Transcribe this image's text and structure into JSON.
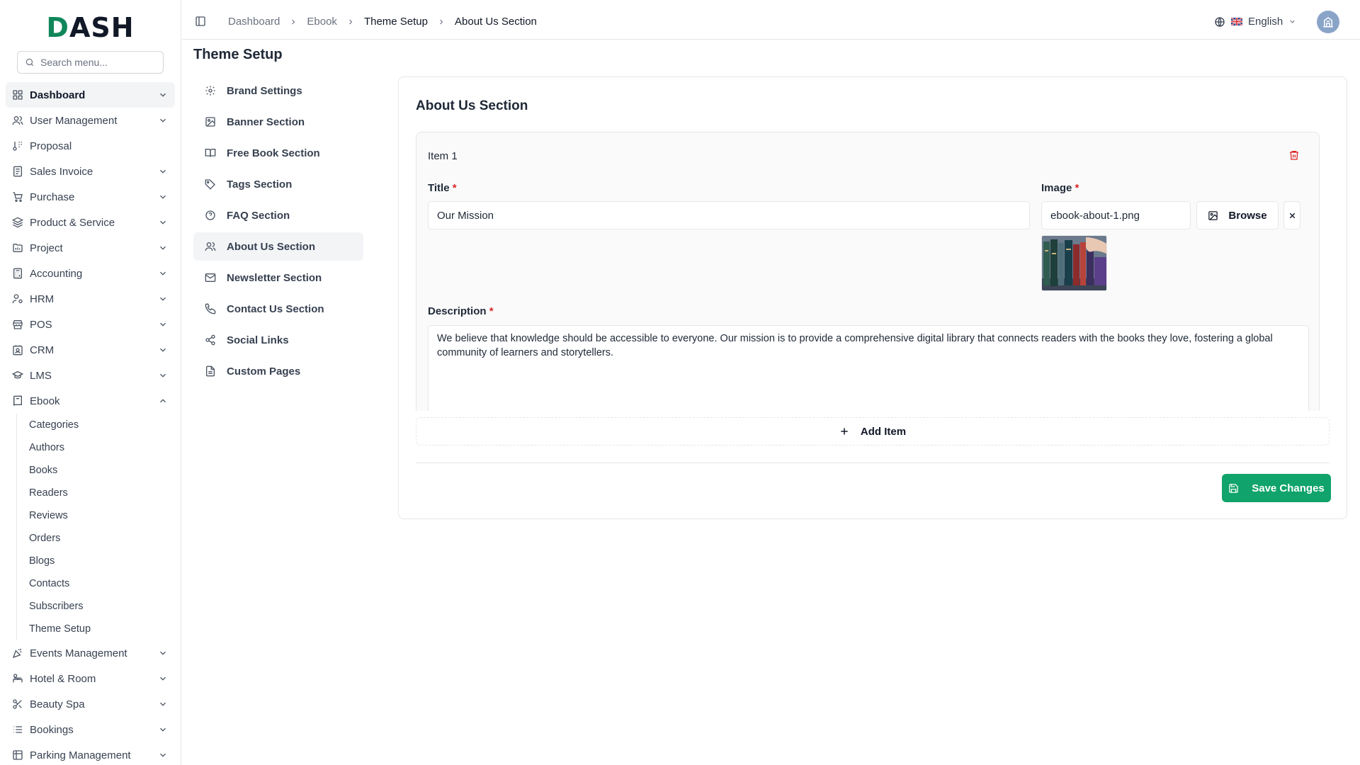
{
  "brand": {
    "logo_prefix": "D",
    "logo_rest": "ASH",
    "accent": "#10a36b"
  },
  "search": {
    "placeholder": "Search menu..."
  },
  "sidebar": {
    "items": [
      {
        "label": "Dashboard",
        "icon": "grid-icon",
        "active": true,
        "chevron": "down"
      },
      {
        "label": "User Management",
        "icon": "users-icon",
        "chevron": "down"
      },
      {
        "label": "Proposal",
        "icon": "proposal-icon"
      },
      {
        "label": "Sales Invoice",
        "icon": "invoice-icon",
        "chevron": "down"
      },
      {
        "label": "Purchase",
        "icon": "cart-icon",
        "chevron": "down"
      },
      {
        "label": "Product & Service",
        "icon": "layers-icon",
        "chevron": "down"
      },
      {
        "label": "Project",
        "icon": "folder-icon",
        "chevron": "down"
      },
      {
        "label": "Accounting",
        "icon": "calculator-icon",
        "chevron": "down"
      },
      {
        "label": "HRM",
        "icon": "user-cog-icon",
        "chevron": "down"
      },
      {
        "label": "POS",
        "icon": "store-icon",
        "chevron": "down"
      },
      {
        "label": "CRM",
        "icon": "contact-icon",
        "chevron": "down"
      },
      {
        "label": "LMS",
        "icon": "graduation-cap-icon",
        "chevron": "down"
      },
      {
        "label": "Ebook",
        "icon": "book-icon",
        "chevron": "up"
      }
    ],
    "ebook_sub": [
      "Categories",
      "Authors",
      "Books",
      "Readers",
      "Reviews",
      "Orders",
      "Blogs",
      "Contacts",
      "Subscribers",
      "Theme Setup"
    ],
    "items_after": [
      {
        "label": "Events Management",
        "icon": "party-icon",
        "chevron": "down"
      },
      {
        "label": "Hotel & Room",
        "icon": "bed-icon",
        "chevron": "down"
      },
      {
        "label": "Beauty Spa",
        "icon": "scissors-icon",
        "chevron": "down"
      },
      {
        "label": "Bookings",
        "icon": "list-icon",
        "chevron": "down"
      },
      {
        "label": "Parking Management",
        "icon": "parking-icon",
        "chevron": "down"
      }
    ]
  },
  "header": {
    "breadcrumbs": [
      "Dashboard",
      "Ebook",
      "Theme Setup",
      "About Us Section"
    ],
    "language": "English"
  },
  "page": {
    "title": "Theme Setup",
    "setup_nav": [
      {
        "label": "Brand Settings",
        "icon": "settings-icon"
      },
      {
        "label": "Banner Section",
        "icon": "image-icon"
      },
      {
        "label": "Free Book Section",
        "icon": "book-open-icon"
      },
      {
        "label": "Tags Section",
        "icon": "tag-icon"
      },
      {
        "label": "FAQ Section",
        "icon": "help-circle-icon"
      },
      {
        "label": "About Us Section",
        "icon": "users-icon",
        "active": true
      },
      {
        "label": "Newsletter Section",
        "icon": "mail-icon"
      },
      {
        "label": "Contact Us Section",
        "icon": "phone-icon"
      },
      {
        "label": "Social Links",
        "icon": "share-icon"
      },
      {
        "label": "Custom Pages",
        "icon": "file-icon"
      }
    ]
  },
  "section": {
    "title": "About Us Section",
    "item": {
      "label": "Item 1",
      "title_label": "Title",
      "title_value": "Our Mission",
      "image_label": "Image",
      "image_value": "ebook-about-1.png",
      "browse_label": "Browse",
      "description_label": "Description",
      "description_value": "We believe that knowledge should be accessible to everyone. Our mission is to provide a comprehensive digital library that connects readers with the books they love, fostering a global community of learners and storytellers.",
      "required_mark": "*"
    },
    "add_item_label": "Add Item",
    "save_label": "Save Changes"
  }
}
